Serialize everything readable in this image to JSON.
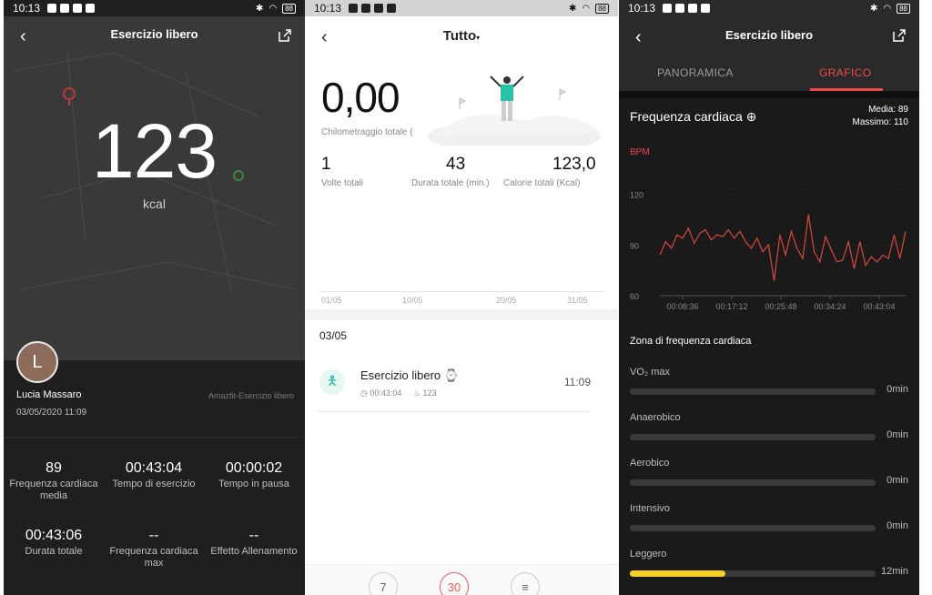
{
  "status": {
    "time": "10:13",
    "battery": "88"
  },
  "screen1": {
    "title": "Esercizio libero",
    "back_icon": "chevron-left-icon",
    "share_icon": "share-icon",
    "calories": "123",
    "calories_unit": "kcal",
    "avatar_letter": "L",
    "user_name": "Lucia Massaro",
    "date": "03/05/2020 11:09",
    "source": "Amazfit-Esercizio libero",
    "stats": [
      {
        "value": "89",
        "label": "Frequenza cardiaca media"
      },
      {
        "value": "00:43:04",
        "label": "Tempo di esercizio"
      },
      {
        "value": "00:00:02",
        "label": "Tempo in pausa"
      },
      {
        "value": "00:43:06",
        "label": "Durata totale"
      },
      {
        "value": "--",
        "label": "Frequenza cardiaca max"
      },
      {
        "value": "--",
        "label": "Effetto Allenamento"
      }
    ]
  },
  "screen2": {
    "title": "Tutto",
    "total_km": "0,00",
    "total_km_label": "Chilometraggio totale (",
    "times_value": "1",
    "times_label": "Volte totali",
    "duration_value": "43",
    "duration_label": "Durata totale (min.)",
    "calories_value": "123,0",
    "calories_label": "Calorie totali (Kcal)",
    "chart_dates": [
      "01/05",
      "10/05",
      "20/05",
      "31/05"
    ],
    "day": "03/05",
    "activity": {
      "name": "Esercizio libero",
      "duration": "00:43:04",
      "calories": "123",
      "time": "11:09"
    },
    "bottom_buttons": [
      "7",
      "30",
      "≡"
    ]
  },
  "screen3": {
    "title": "Esercizio libero",
    "tabs": [
      "PANORAMICA",
      "GRAFICO"
    ],
    "active_tab": "GRAFICO",
    "heart_title": "Frequenza cardiaca",
    "media": "Media: 89",
    "massimo": "Massimo: 110",
    "unit": "BPM",
    "zone_title": "Zona di frequenza cardiaca",
    "zones": [
      {
        "name": "VO₂ max",
        "value": "0min",
        "fraction": 0
      },
      {
        "name": "Anaerobico",
        "value": "0min",
        "fraction": 0
      },
      {
        "name": "Aerobico",
        "value": "0min",
        "fraction": 0
      },
      {
        "name": "Intensivo",
        "value": "0min",
        "fraction": 0
      },
      {
        "name": "Leggero",
        "value": "12min",
        "fraction": 0.39
      }
    ]
  },
  "chart_data": {
    "type": "line",
    "ylabel": "BPM",
    "ylim": [
      60,
      130
    ],
    "yticks": [
      120,
      90,
      60
    ],
    "xticks": [
      "00:08:36",
      "00:17:12",
      "00:25:48",
      "00:34:24",
      "00:43:04"
    ],
    "series": [
      {
        "color": "#d9483b",
        "x": [
          0,
          1,
          2,
          3,
          4,
          5,
          6,
          7,
          8,
          9,
          10,
          11,
          12,
          13,
          14,
          15,
          16,
          17,
          18,
          19,
          20,
          21,
          22,
          23,
          24,
          25,
          26,
          27,
          28,
          29,
          30,
          31,
          32,
          33,
          34,
          35,
          36,
          37,
          38,
          39,
          40,
          41,
          42,
          43
        ],
        "values": [
          84,
          92,
          88,
          96,
          94,
          100,
          91,
          97,
          99,
          93,
          96,
          95,
          99,
          94,
          98,
          92,
          88,
          94,
          86,
          90,
          69,
          96,
          84,
          98,
          88,
          82,
          108,
          86,
          80,
          95,
          87,
          80,
          81,
          92,
          76,
          92,
          78,
          83,
          80,
          84,
          82,
          96,
          82,
          98
        ]
      }
    ]
  }
}
